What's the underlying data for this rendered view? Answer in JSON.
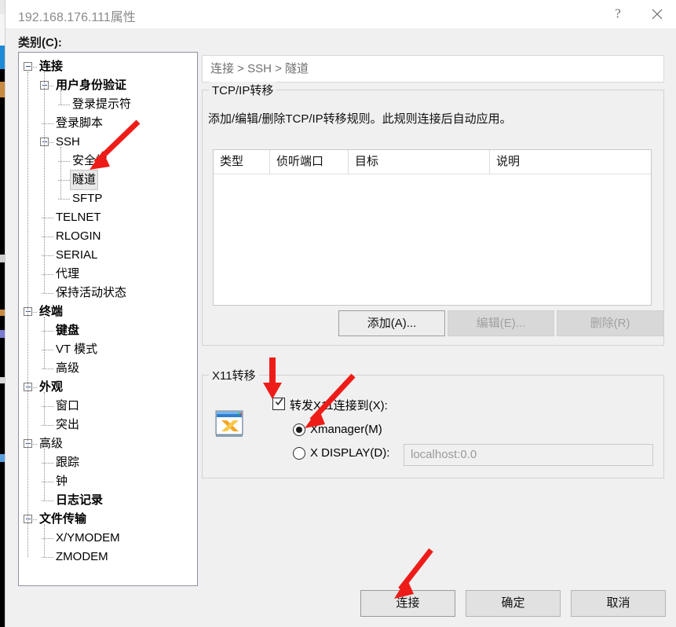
{
  "window": {
    "title": "192.168.176.111属性",
    "help_button": "?",
    "close_button": "×",
    "category_label": "类别(C):"
  },
  "tree": {
    "nodes": [
      {
        "label": "连接",
        "depth": 0,
        "bold": true,
        "expander": true,
        "selected": false
      },
      {
        "label": "用户身份验证",
        "depth": 1,
        "bold": true,
        "expander": true,
        "selected": false
      },
      {
        "label": "登录提示符",
        "depth": 2,
        "bold": false,
        "expander": false,
        "selected": false
      },
      {
        "label": "登录脚本",
        "depth": 1,
        "bold": false,
        "expander": false,
        "selected": false
      },
      {
        "label": "SSH",
        "depth": 1,
        "bold": false,
        "expander": true,
        "selected": false
      },
      {
        "label": "安全性",
        "depth": 2,
        "bold": false,
        "expander": false,
        "selected": false
      },
      {
        "label": "隧道",
        "depth": 2,
        "bold": false,
        "expander": false,
        "selected": true
      },
      {
        "label": "SFTP",
        "depth": 2,
        "bold": false,
        "expander": false,
        "selected": false
      },
      {
        "label": "TELNET",
        "depth": 1,
        "bold": false,
        "expander": false,
        "selected": false
      },
      {
        "label": "RLOGIN",
        "depth": 1,
        "bold": false,
        "expander": false,
        "selected": false
      },
      {
        "label": "SERIAL",
        "depth": 1,
        "bold": false,
        "expander": false,
        "selected": false
      },
      {
        "label": "代理",
        "depth": 1,
        "bold": false,
        "expander": false,
        "selected": false
      },
      {
        "label": "保持活动状态",
        "depth": 1,
        "bold": false,
        "expander": false,
        "selected": false
      },
      {
        "label": "终端",
        "depth": 0,
        "bold": true,
        "expander": true,
        "selected": false
      },
      {
        "label": "键盘",
        "depth": 1,
        "bold": true,
        "expander": false,
        "selected": false
      },
      {
        "label": "VT 模式",
        "depth": 1,
        "bold": false,
        "expander": false,
        "selected": false
      },
      {
        "label": "高级",
        "depth": 1,
        "bold": false,
        "expander": false,
        "selected": false
      },
      {
        "label": "外观",
        "depth": 0,
        "bold": true,
        "expander": true,
        "selected": false
      },
      {
        "label": "窗口",
        "depth": 1,
        "bold": false,
        "expander": false,
        "selected": false
      },
      {
        "label": "突出",
        "depth": 1,
        "bold": false,
        "expander": false,
        "selected": false
      },
      {
        "label": "高级",
        "depth": 0,
        "bold": false,
        "expander": true,
        "selected": false
      },
      {
        "label": "跟踪",
        "depth": 1,
        "bold": false,
        "expander": false,
        "selected": false
      },
      {
        "label": "钟",
        "depth": 1,
        "bold": false,
        "expander": false,
        "selected": false
      },
      {
        "label": "日志记录",
        "depth": 1,
        "bold": true,
        "expander": false,
        "selected": false
      },
      {
        "label": "文件传输",
        "depth": 0,
        "bold": true,
        "expander": true,
        "selected": false
      },
      {
        "label": "X/YMODEM",
        "depth": 1,
        "bold": false,
        "expander": false,
        "selected": false
      },
      {
        "label": "ZMODEM",
        "depth": 1,
        "bold": false,
        "expander": false,
        "selected": false
      }
    ]
  },
  "breadcrumb": "连接 > SSH > 隧道",
  "tcp_group": {
    "legend": "TCP/IP转移",
    "description": "添加/编辑/删除TCP/IP转移规则。此规则连接后自动应用。",
    "table": {
      "columns": [
        "类型",
        "侦听端口",
        "目标",
        "说明"
      ],
      "rows": []
    },
    "buttons": {
      "add": "添加(A)...",
      "edit": "编辑(E)...",
      "delete": "删除(R)"
    }
  },
  "x11_group": {
    "legend": "X11转移",
    "icon_name": "xmanager-icon",
    "forward_checkbox": {
      "label": "转发X11连接到(X):",
      "checked": true
    },
    "radio_xmanager": {
      "label": "Xmanager(M)",
      "selected": true
    },
    "radio_xdisplay": {
      "label": "X DISPLAY(D):",
      "selected": false
    },
    "display_input": {
      "value": "localhost:0.0",
      "enabled": false
    }
  },
  "footer": {
    "connect": "连接",
    "ok": "确定",
    "cancel": "取消"
  },
  "annotations": {
    "color": "#ee1c18",
    "arrows": [
      {
        "name": "arrow-to-tunnel",
        "target": "隧道"
      },
      {
        "name": "arrow-to-x11-checkbox",
        "target": "转发X11连接到(X):"
      },
      {
        "name": "arrow-to-xmanager",
        "target": "Xmanager(M)"
      },
      {
        "name": "arrow-to-connect",
        "target": "连接"
      }
    ]
  }
}
